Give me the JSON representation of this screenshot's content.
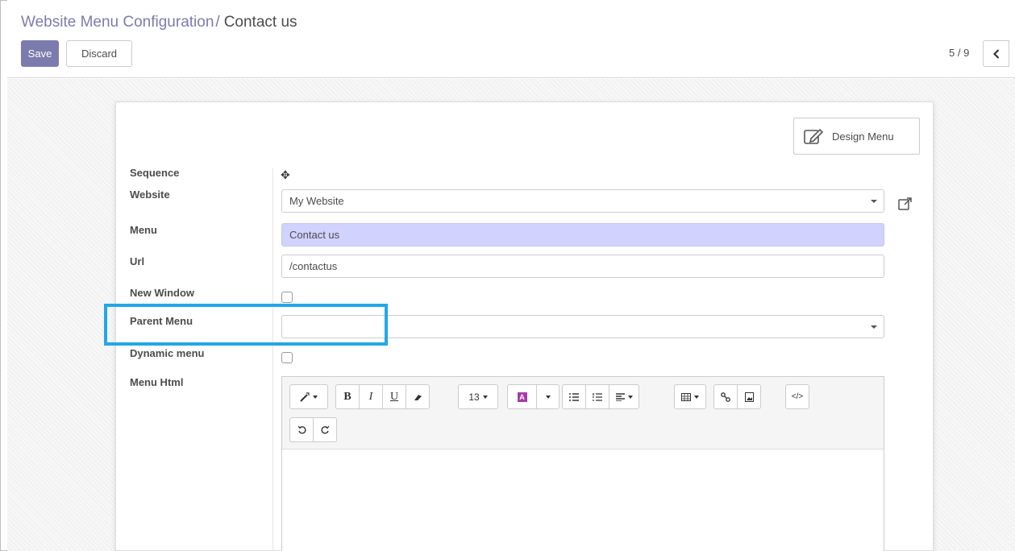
{
  "breadcrumb": {
    "parent": "Website Menu Configuration",
    "separator": "/",
    "current": "Contact us"
  },
  "buttons": {
    "save": "Save",
    "discard": "Discard"
  },
  "pager": {
    "value": "5 / 9"
  },
  "form": {
    "design_menu_label": "Design Menu",
    "fields": {
      "sequence": {
        "label": "Sequence"
      },
      "website": {
        "label": "Website",
        "value": "My Website"
      },
      "menu": {
        "label": "Menu",
        "value": "Contact us"
      },
      "url": {
        "label": "Url",
        "value": "/contactus"
      },
      "new_window": {
        "label": "New Window",
        "checked": false
      },
      "parent_menu": {
        "label": "Parent Menu",
        "value": ""
      },
      "dynamic_menu": {
        "label": "Dynamic menu",
        "checked": false
      },
      "menu_html": {
        "label": "Menu Html"
      }
    }
  },
  "editor_toolbar": {
    "font_size": "13",
    "bold": "B",
    "italic": "I",
    "underline": "U"
  },
  "colors": {
    "primary": "#7c7bad",
    "required_field": "#d2d2ff",
    "highlight": "#22a7e8"
  }
}
